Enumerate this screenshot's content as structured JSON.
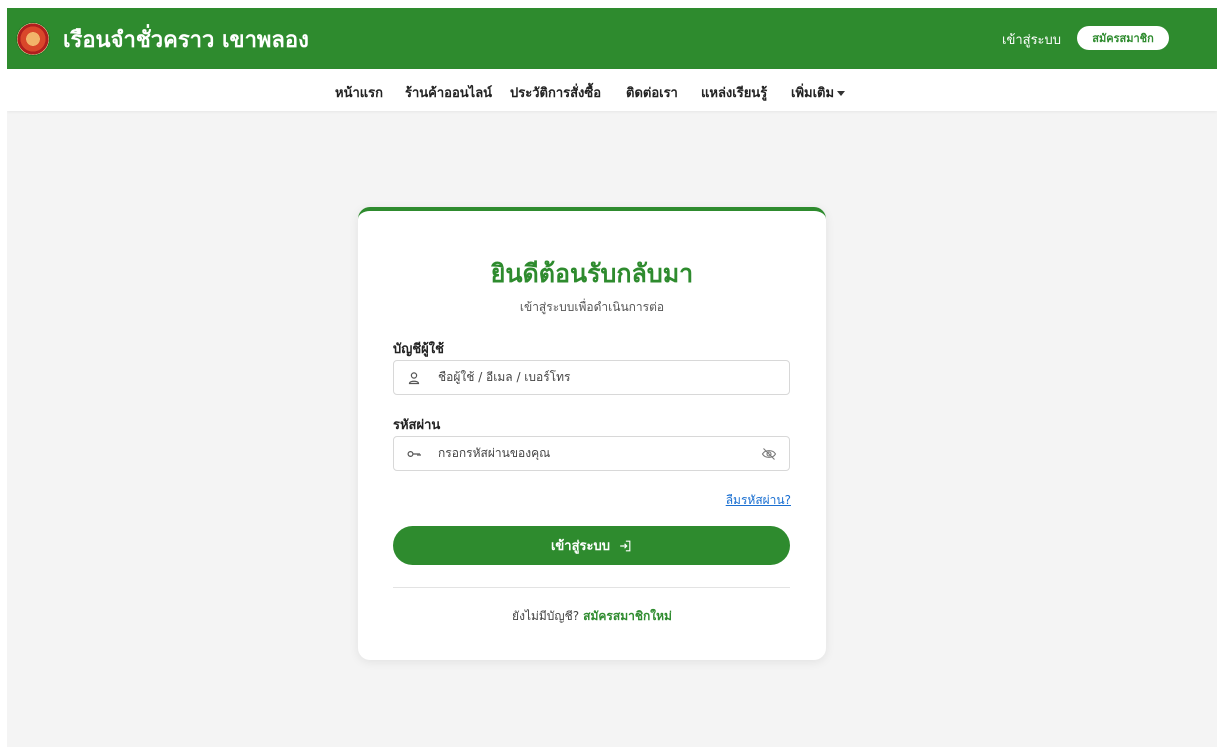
{
  "header": {
    "brand": "เรือนจำชั่วคราว เขาพลอง",
    "login_link": "เข้าสู่ระบบ",
    "register_button": "สมัครสมาชิก"
  },
  "nav": {
    "items": [
      {
        "label": "หน้าแรก"
      },
      {
        "label": "ร้านค้าออนไลน์"
      },
      {
        "label": "ประวัติการสั่งซื้อ"
      },
      {
        "label": "ติดต่อเรา"
      },
      {
        "label": "แหล่งเรียนรู้"
      },
      {
        "label": "เพิ่มเติม"
      }
    ]
  },
  "login_card": {
    "title": "ยินดีต้อนรับกลับมา",
    "subtitle": "เข้าสู่ระบบเพื่อดำเนินการต่อ",
    "username": {
      "label": "บัญชีผู้ใช้",
      "placeholder": "ชื่อผู้ใช้ / อีเมล / เบอร์โทร",
      "value": ""
    },
    "password": {
      "label": "รหัสผ่าน",
      "placeholder": "กรอกรหัสผ่านของคุณ",
      "value": ""
    },
    "forgot_password": "ลืมรหัสผ่าน?",
    "submit_label": "เข้าสู่ระบบ",
    "no_account_text": "ยังไม่มีบัญชี?",
    "register_link": "สมัครสมาชิกใหม่"
  },
  "icons": {
    "username": "user-icon",
    "password": "key-icon",
    "toggle_password": "eye-slash-icon",
    "submit": "sign-in-icon",
    "dropdown": "caret-down-icon"
  },
  "colors": {
    "primary": "#2e8b2e",
    "link": "#1a6fd1",
    "background": "#f4f4f4"
  }
}
